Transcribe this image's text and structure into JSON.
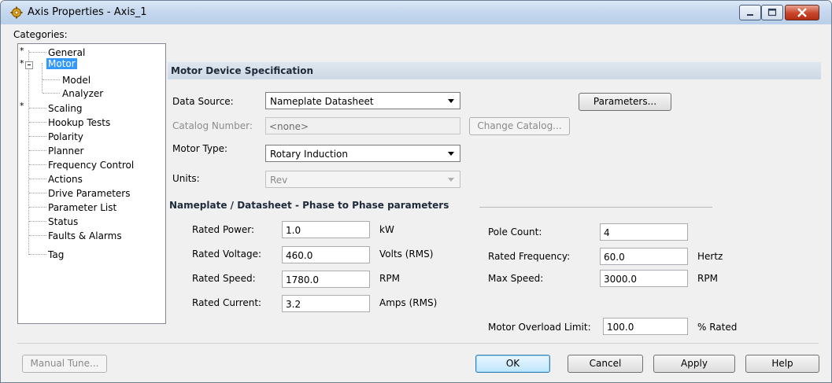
{
  "window": {
    "title": "Axis Properties - Axis_1"
  },
  "categories": {
    "label": "Categories:",
    "items": [
      {
        "label": "General",
        "starred": true
      },
      {
        "label": "Motor",
        "starred": true,
        "selected": true
      },
      {
        "label": "Model"
      },
      {
        "label": "Analyzer"
      },
      {
        "label": "Scaling",
        "starred": true
      },
      {
        "label": "Hookup Tests"
      },
      {
        "label": "Polarity"
      },
      {
        "label": "Planner"
      },
      {
        "label": "Frequency Control"
      },
      {
        "label": "Actions"
      },
      {
        "label": "Drive Parameters"
      },
      {
        "label": "Parameter List"
      },
      {
        "label": "Status"
      },
      {
        "label": "Faults & Alarms"
      },
      {
        "label": "Tag"
      }
    ],
    "star": "*"
  },
  "section": {
    "title": "Motor Device Specification"
  },
  "form": {
    "data_source_label": "Data Source:",
    "data_source_value": "Nameplate Datasheet",
    "parameters_button": "Parameters...",
    "catalog_label": "Catalog Number:",
    "catalog_value": "<none>",
    "change_catalog_button": "Change Catalog...",
    "motor_type_label": "Motor Type:",
    "motor_type_value": "Rotary Induction",
    "units_label": "Units:",
    "units_value": "Rev"
  },
  "nameplate": {
    "title": "Nameplate / Datasheet - Phase to Phase parameters",
    "rated_power": {
      "label": "Rated Power:",
      "value": "1.0",
      "unit": "kW"
    },
    "rated_voltage": {
      "label": "Rated Voltage:",
      "value": "460.0",
      "unit": "Volts (RMS)"
    },
    "rated_speed": {
      "label": "Rated Speed:",
      "value": "1780.0",
      "unit": "RPM"
    },
    "rated_current": {
      "label": "Rated Current:",
      "value": "3.2",
      "unit": "Amps (RMS)"
    },
    "pole_count": {
      "label": "Pole Count:",
      "value": "4"
    },
    "rated_frequency": {
      "label": "Rated Frequency:",
      "value": "60.0",
      "unit": "Hertz"
    },
    "max_speed": {
      "label": "Max Speed:",
      "value": "3000.0",
      "unit": "RPM"
    },
    "overload_limit": {
      "label": "Motor Overload Limit:",
      "value": "100.0",
      "unit": "% Rated"
    }
  },
  "buttons": {
    "manual_tune": "Manual Tune...",
    "ok": "OK",
    "cancel": "Cancel",
    "apply": "Apply",
    "help": "Help"
  },
  "icons": {
    "app": "gear-icon",
    "minimize": "minimize-icon",
    "maximize": "maximize-icon",
    "close": "close-icon"
  },
  "colors": {
    "selection": "#3399ff",
    "section_bar": "#d6dfe9",
    "close_button": "#c9452a"
  }
}
